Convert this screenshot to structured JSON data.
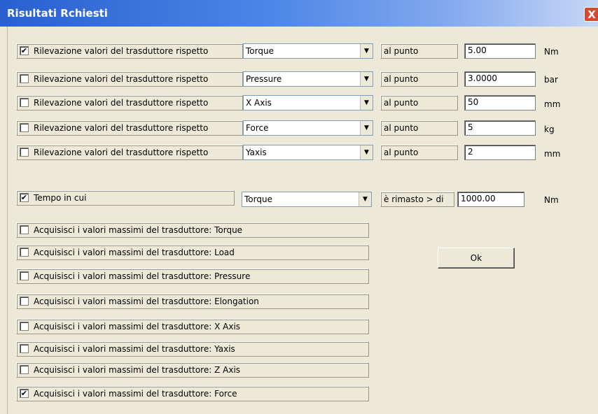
{
  "window": {
    "title": "Risultati Rchiesti",
    "close_symbol": "X"
  },
  "rows": [
    {
      "checked": true,
      "label": "Rilevazione valori del trasduttore rispetto",
      "select": "Torque",
      "static": "al punto",
      "value": "5.00",
      "unit": "Nm"
    },
    {
      "checked": false,
      "label": "Rilevazione valori del trasduttore rispetto",
      "select": "Pressure",
      "static": "al punto",
      "value": "3.0000",
      "unit": "bar"
    },
    {
      "checked": false,
      "label": "Rilevazione valori del trasduttore rispetto",
      "select": "X Axis",
      "static": "al punto",
      "value": "50",
      "unit": "mm"
    },
    {
      "checked": false,
      "label": "Rilevazione valori del trasduttore rispetto",
      "select": "Force",
      "static": "al punto",
      "value": "5",
      "unit": "kg"
    },
    {
      "checked": false,
      "label": "Rilevazione valori del trasduttore rispetto",
      "select": "Yaxis",
      "static": "al punto",
      "value": "2",
      "unit": "mm"
    }
  ],
  "tempo": {
    "checked": true,
    "label": "Tempo in cui",
    "select": "Torque",
    "static": "è rimasto > di",
    "value": "1000.00",
    "unit": "Nm"
  },
  "acquire": [
    {
      "checked": false,
      "label": "Acquisisci i valori massimi del trasduttore: Torque"
    },
    {
      "checked": false,
      "label": "Acquisisci i valori massimi del trasduttore: Load"
    },
    {
      "checked": false,
      "label": "Acquisisci i valori massimi del trasduttore: Pressure"
    },
    {
      "checked": false,
      "label": "Acquisisci i valori massimi del trasduttore: Elongation"
    },
    {
      "checked": false,
      "label": "Acquisisci i valori massimi del trasduttore: X Axis"
    },
    {
      "checked": false,
      "label": "Acquisisci i valori massimi del trasduttore: Yaxis"
    },
    {
      "checked": false,
      "label": "Acquisisci i valori massimi del trasduttore: Z Axis"
    },
    {
      "checked": true,
      "label": "Acquisisci i valori massimi del trasduttore: Force"
    }
  ],
  "ok_label": "Ok",
  "check_glyph": "✔",
  "dropdown_glyph": "▼"
}
